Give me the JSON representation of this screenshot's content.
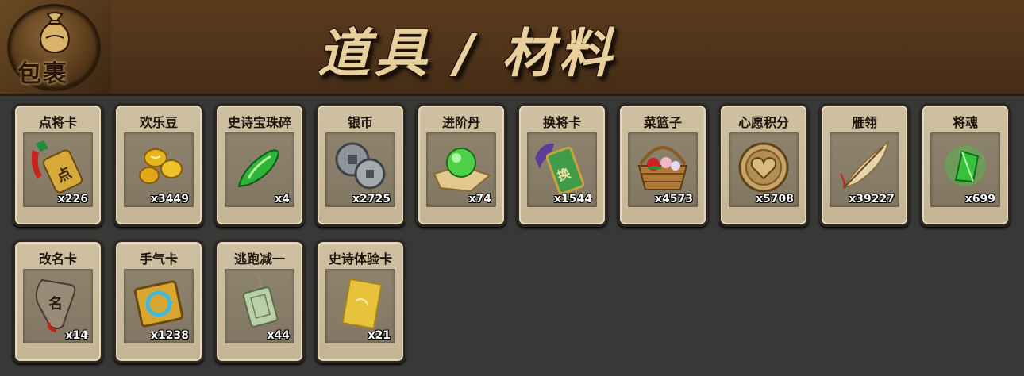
{
  "header": {
    "emblem_text": "包裹",
    "title": "道具 / 材料"
  },
  "items": [
    {
      "name": "点将卡",
      "count": "x226",
      "icon": "general-card-icon"
    },
    {
      "name": "欢乐豆",
      "count": "x3449",
      "icon": "golden-beans-icon"
    },
    {
      "name": "史诗宝珠碎",
      "count": "x4",
      "icon": "green-shard-icon"
    },
    {
      "name": "银币",
      "count": "x2725",
      "icon": "silver-coins-icon"
    },
    {
      "name": "进阶丹",
      "count": "x74",
      "icon": "green-orb-icon"
    },
    {
      "name": "换将卡",
      "count": "x1544",
      "icon": "swap-card-icon"
    },
    {
      "name": "菜篮子",
      "count": "x4573",
      "icon": "basket-icon"
    },
    {
      "name": "心愿积分",
      "count": "x5708",
      "icon": "heart-coin-icon"
    },
    {
      "name": "雁翎",
      "count": "x39227",
      "icon": "feather-icon"
    },
    {
      "name": "将魂",
      "count": "x699",
      "icon": "soul-crystal-icon"
    },
    {
      "name": "改名卡",
      "count": "x14",
      "icon": "rename-card-icon"
    },
    {
      "name": "手气卡",
      "count": "x1238",
      "icon": "luck-card-icon"
    },
    {
      "name": "逃跑减一",
      "count": "x44",
      "icon": "jade-tag-icon"
    },
    {
      "name": "史诗体验卡",
      "count": "x21",
      "icon": "gold-card-icon"
    }
  ],
  "colors": {
    "header_brown": "#5a3b1c",
    "card_tan": "#cfc0a2",
    "background": "#383837"
  }
}
